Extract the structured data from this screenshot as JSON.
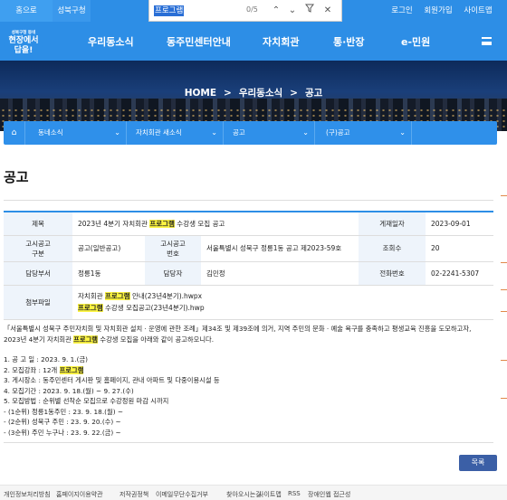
{
  "topbar": {
    "home": "홈으로",
    "gu": "성북구청",
    "login": "로그인",
    "join": "회원가입",
    "sitemap": "사이트맵"
  },
  "find": {
    "query": "프로그램",
    "count": "0/5"
  },
  "logo": {
    "small": "성북구청 동네",
    "line1": "현장에서",
    "line2": "답을!"
  },
  "nav": [
    "우리동소식",
    "동주민센터안내",
    "자치회관",
    "통·반장",
    "e-민원"
  ],
  "breadcrumb": {
    "home": "HOME",
    "sep": ">",
    "c1": "우리동소식",
    "c2": "공고"
  },
  "subnav": [
    "동네소식",
    "자치회관 새소식",
    "공고",
    "(구)공고"
  ],
  "page_title": "공고",
  "info": {
    "title_label": "제목",
    "title_pre": "2023년 4분기 자치회관 ",
    "title_mark": "프로그램",
    "title_post": " 수강생 모집 공고",
    "date_label": "게재일자",
    "date_value": "2023-09-01",
    "type_label_1": "고시공고",
    "type_label_2": "구분",
    "type_value": "공고(일반공고)",
    "no_label_1": "고시공고",
    "no_label_2": "번호",
    "no_value": "서울특별시 성북구 정릉1동 공고 제2023-59호",
    "views_label": "조회수",
    "views_value": "20",
    "dept_label": "담당부서",
    "dept_value": "정릉1동",
    "person_label": "담당자",
    "person_value": "김민정",
    "phone_label": "전화번호",
    "phone_value": "02-2241-5307",
    "attach_label": "첨부파일",
    "file1_pre": "자치회관 ",
    "file1_mark": "프로그램",
    "file1_post": " 안내(23년4분기).hwpx",
    "file2_mark": "프로그램",
    "file2_post": " 수강생 모집공고(23년4분기).hwp"
  },
  "content": {
    "intro_1": "「서울특별시 성북구 주민자치회 및 자치회관 설치 · 운영에 관한 조례」제34조 및 제39조에 의거, 지역 주민의 문화 · 예술 욕구를 충족하고 평생교육 진흥을 도모하고자,",
    "intro_2_pre": "2023년 4분기 자치회관 ",
    "intro_2_mark": "프로그램",
    "intro_2_post": " 수강생 모집을 아래와 같이 공고하오니다.",
    "l1": "1. 공 고 일 : 2023. 9. 1.(금)",
    "l2_pre": "2. 모집강좌 : 12개 ",
    "l2_mark": "프로그램",
    "l3": "3. 게시장소 : 동주민센터 게시판 및 홈페이지, 관내 아파트 및 다중이용시설 등",
    "l4": "4. 모집기간 : 2023. 9. 18.(월) ~ 9. 27.(수)",
    "l5": "5. 모집방법 : 순위별 선착순 모집으로 수강정원 마감 시까지",
    "l6": "- (1순위) 정릉1동주민 : 23. 9. 18.(월) ~",
    "l7": "- (2순위) 성북구 주민 : 23. 9. 20.(수) ~",
    "l8": "- (3순위) 주민 누구나 : 23. 9. 22.(금) ~"
  },
  "list_button": "목록",
  "footer": [
    "개인정보처리방침",
    "홈페이지이용약관",
    "저작권정책",
    "이메일무단수집거부",
    "찾아오시는길",
    "사이트맵",
    "RSS",
    "장애인웹 접근성"
  ],
  "colors": {
    "primary": "#2d8ee6",
    "highlight": "#fdf542",
    "button": "#3b5fa6"
  }
}
